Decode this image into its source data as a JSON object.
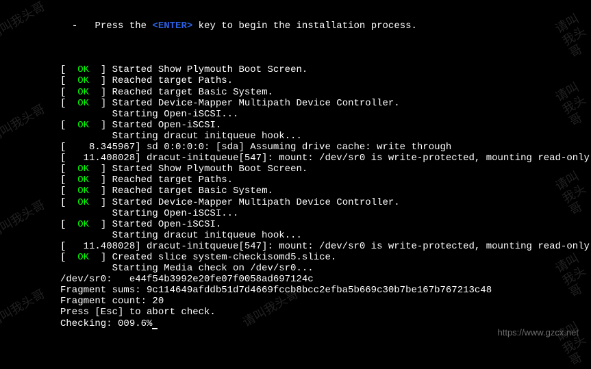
{
  "header": {
    "dash": "-",
    "press": "Press the ",
    "enter": "<ENTER>",
    "rest": " key to begin the installation process."
  },
  "lines": [
    {
      "type": "ok",
      "text": "Started Show Plymouth Boot Screen."
    },
    {
      "type": "ok",
      "text": "Reached target Paths."
    },
    {
      "type": "ok",
      "text": "Reached target Basic System."
    },
    {
      "type": "ok",
      "text": "Started Device-Mapper Multipath Device Controller."
    },
    {
      "type": "plain",
      "text": "         Starting Open-iSCSI..."
    },
    {
      "type": "ok",
      "text": "Started Open-iSCSI."
    },
    {
      "type": "plain",
      "text": "         Starting dracut initqueue hook..."
    },
    {
      "type": "plain",
      "text": "[    8.345967] sd 0:0:0:0: [sda] Assuming drive cache: write through"
    },
    {
      "type": "plain",
      "text": "[   11.408028] dracut-initqueue[547]: mount: /dev/sr0 is write-protected, mounting read-only"
    },
    {
      "type": "ok",
      "text": "Started Show Plymouth Boot Screen."
    },
    {
      "type": "ok",
      "text": "Reached target Paths."
    },
    {
      "type": "ok",
      "text": "Reached target Basic System."
    },
    {
      "type": "ok",
      "text": "Started Device-Mapper Multipath Device Controller."
    },
    {
      "type": "plain",
      "text": "         Starting Open-iSCSI..."
    },
    {
      "type": "ok",
      "text": "Started Open-iSCSI."
    },
    {
      "type": "plain",
      "text": "         Starting dracut initqueue hook..."
    },
    {
      "type": "plain",
      "text": "[   11.408028] dracut-initqueue[547]: mount: /dev/sr0 is write-protected, mounting read-only"
    },
    {
      "type": "ok",
      "text": "Created slice system-checkisomd5.slice."
    },
    {
      "type": "plain",
      "text": "         Starting Media check on /dev/sr0..."
    },
    {
      "type": "plain",
      "text": "/dev/sr0:   e44f54b3992e20fe07f0058ad697124c"
    },
    {
      "type": "plain",
      "text": "Fragment sums: 9c114649afddb51d7d4669fccb8bcc2efba5b669c30b7be167b767213c48"
    },
    {
      "type": "plain",
      "text": "Fragment count: 20"
    },
    {
      "type": "plain",
      "text": "Press [Esc] to abort check."
    },
    {
      "type": "checking",
      "text": "Checking: 009.6%"
    }
  ],
  "bracket": {
    "open": "[  ",
    "ok": "OK",
    "close": "  ] "
  },
  "watermark_text": "请叫我头哥",
  "url": "https://www.gzcx.net"
}
